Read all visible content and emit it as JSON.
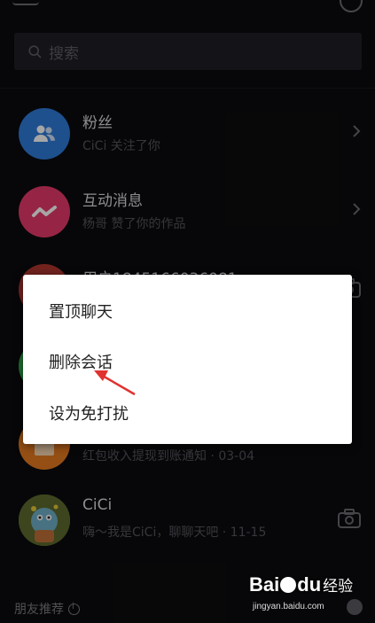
{
  "search": {
    "placeholder": "搜索"
  },
  "conversations": [
    {
      "title": "粉丝",
      "subtitle": "CiCi 关注了你",
      "avatar_color": "#2f7bd9",
      "avatar_icon": "fans-icon",
      "trailing": "chevron-right-icon"
    },
    {
      "title": "互动消息",
      "subtitle": "杨哥 赞了你的作品",
      "avatar_color": "#e63a6b",
      "avatar_icon": "interaction-icon",
      "trailing": "chevron-right-icon"
    },
    {
      "title": "用户1845166036081",
      "subtitle": "",
      "avatar_color": "#b0362f",
      "avatar_icon": "user-avatar",
      "trailing": "camera-icon"
    },
    {
      "title": "",
      "subtitle": "",
      "avatar_color": "#2ea84a",
      "avatar_icon": "green-avatar",
      "trailing": ""
    },
    {
      "title": "",
      "subtitle": "红包收入提现到账通知 · 03-04",
      "avatar_color": "#e57a1f",
      "avatar_icon": "wallet-avatar",
      "trailing": ""
    },
    {
      "title": "CiCi",
      "subtitle": "嗨～我是CiCi，聊聊天吧 · 11-15",
      "avatar_color": "#7a8a3c",
      "avatar_icon": "cici-avatar",
      "trailing": "camera-icon"
    }
  ],
  "menu": {
    "items": [
      "置顶聊天",
      "删除会话",
      "设为免打扰"
    ]
  },
  "footer": {
    "friends_title": "朋友推荐"
  },
  "watermark": {
    "brand": "Bai",
    "brand_end": "du",
    "cn": "经验",
    "url": "jingyan.baidu.com"
  },
  "colors": {
    "background": "#0c0c0e",
    "menu_bg": "#ffffff",
    "arrow": "#e0322f"
  }
}
